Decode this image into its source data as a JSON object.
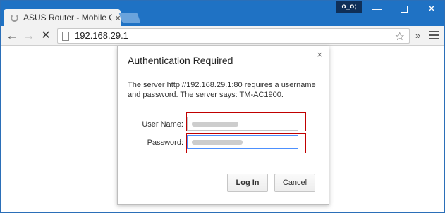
{
  "window": {
    "tab_title": "ASUS Router - Mobile QIS",
    "tab_close": "×",
    "profile_badge": "o_o;",
    "minimize": "—",
    "close": "✕"
  },
  "toolbar": {
    "back_icon": "←",
    "forward_icon": "→",
    "stop_icon": "✕",
    "url": "192.168.29.1",
    "star_icon": "☆",
    "extensions": "»"
  },
  "dialog": {
    "title": "Authentication Required",
    "close_icon": "×",
    "message": "The server http://192.168.29.1:80 requires a username and password. The server says: TM-AC1900.",
    "username_label": "User Name:",
    "password_label": "Password:",
    "login_button": "Log In",
    "cancel_button": "Cancel"
  },
  "colors": {
    "titlebar": "#1f72c4",
    "highlight": "#c00000",
    "focus": "#4d90fe"
  }
}
